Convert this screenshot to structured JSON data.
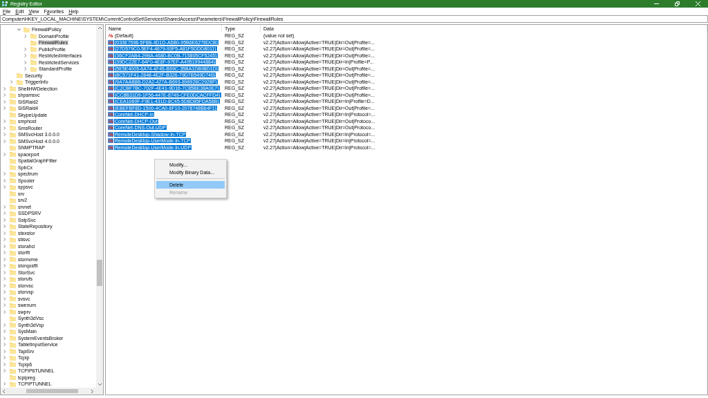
{
  "window": {
    "title": "Registry Editor"
  },
  "menu": [
    {
      "accel": "F",
      "rest": "ile"
    },
    {
      "accel": "E",
      "rest": "dit"
    },
    {
      "accel": "V",
      "rest": "iew"
    },
    {
      "pre": "F",
      "accel": "a",
      "rest": "vorites"
    },
    {
      "accel": "H",
      "rest": "elp"
    }
  ],
  "address": "Computer\\HKEY_LOCAL_MACHINE\\SYSTEM\\CurrentControlSet\\Services\\SharedAccess\\Parameters\\FirewallPolicy\\FirewallRules",
  "tree": [
    {
      "children": [
        {
          "children": [
            {
              "label": "FirewallPolicy",
              "expandable": true,
              "expanded": true,
              "selected": false,
              "children": [
                {
                  "label": "DomainProfile",
                  "expandable": true,
                  "selected": false
                },
                {
                  "label": "FirewallRules",
                  "expandable": false,
                  "selected": true
                },
                {
                  "label": "PublicProfile",
                  "expandable": true,
                  "selected": false
                },
                {
                  "label": "RestrictedInterfaces",
                  "expandable": true,
                  "selected": false
                },
                {
                  "label": "RestrictedServices",
                  "expandable": true,
                  "selected": false
                },
                {
                  "label": "StandardProfile",
                  "expandable": true,
                  "selected": false
                }
              ]
            }
          ]
        },
        {
          "label": "Security",
          "expandable": false,
          "selected": false
        },
        {
          "label": "TriggerInfo",
          "expandable": true,
          "selected": false
        }
      ]
    },
    {
      "label": "ShellHWDetection",
      "expandable": true,
      "selected": false
    },
    {
      "label": "shpamsvc",
      "expandable": true,
      "selected": false
    },
    {
      "label": "SiSRaid2",
      "expandable": true,
      "selected": false
    },
    {
      "label": "SiSRaid4",
      "expandable": true,
      "selected": false
    },
    {
      "label": "SkypeUpdate",
      "expandable": false,
      "selected": false
    },
    {
      "label": "smphost",
      "expandable": true,
      "selected": false
    },
    {
      "label": "SmsRouter",
      "expandable": true,
      "selected": false
    },
    {
      "label": "SMSvcHost 3.0.0.0",
      "expandable": true,
      "selected": false
    },
    {
      "label": "SMSvcHost 4.0.0.0",
      "expandable": true,
      "selected": false
    },
    {
      "label": "SNMPTRAP",
      "expandable": false,
      "selected": false
    },
    {
      "label": "spaceport",
      "expandable": true,
      "selected": false
    },
    {
      "label": "SpatialGraphFilter",
      "expandable": false,
      "selected": false
    },
    {
      "label": "SpbCx",
      "expandable": false,
      "selected": false
    },
    {
      "label": "spectrum",
      "expandable": true,
      "selected": false
    },
    {
      "label": "Spooler",
      "expandable": true,
      "selected": false
    },
    {
      "label": "sppsvc",
      "expandable": true,
      "selected": false
    },
    {
      "label": "srv",
      "expandable": false,
      "selected": false
    },
    {
      "label": "srv2",
      "expandable": false,
      "selected": false
    },
    {
      "label": "srvnet",
      "expandable": true,
      "selected": false
    },
    {
      "label": "SSDPSRV",
      "expandable": true,
      "selected": false
    },
    {
      "label": "SstpSvc",
      "expandable": true,
      "selected": false
    },
    {
      "label": "StateRepository",
      "expandable": true,
      "selected": false
    },
    {
      "label": "stexstor",
      "expandable": true,
      "selected": false
    },
    {
      "label": "stisvc",
      "expandable": true,
      "selected": false
    },
    {
      "label": "storahci",
      "expandable": true,
      "selected": false
    },
    {
      "label": "storflt",
      "expandable": true,
      "selected": false
    },
    {
      "label": "stornvme",
      "expandable": true,
      "selected": false
    },
    {
      "label": "storqosflt",
      "expandable": true,
      "selected": false
    },
    {
      "label": "StorSvc",
      "expandable": true,
      "selected": false
    },
    {
      "label": "storufs",
      "expandable": true,
      "selected": false
    },
    {
      "label": "storvsc",
      "expandable": true,
      "selected": false
    },
    {
      "label": "storvsp",
      "expandable": true,
      "selected": false
    },
    {
      "label": "svsvc",
      "expandable": true,
      "selected": false
    },
    {
      "label": "swenum",
      "expandable": true,
      "selected": false
    },
    {
      "label": "swprv",
      "expandable": true,
      "selected": false
    },
    {
      "label": "Synth3dVsc",
      "expandable": false,
      "selected": false
    },
    {
      "label": "Synth3dVsp",
      "expandable": true,
      "selected": false
    },
    {
      "label": "SysMain",
      "expandable": true,
      "selected": false
    },
    {
      "label": "SystemEventsBroker",
      "expandable": true,
      "selected": false
    },
    {
      "label": "TabletInputService",
      "expandable": true,
      "selected": false
    },
    {
      "label": "TapiSrv",
      "expandable": true,
      "selected": false
    },
    {
      "label": "Tcpip",
      "expandable": true,
      "selected": false
    },
    {
      "label": "Tcpip6",
      "expandable": true,
      "selected": false
    },
    {
      "label": "TCPIP6TUNNEL",
      "expandable": true,
      "selected": false
    },
    {
      "label": "tcpipreg",
      "expandable": false,
      "selected": false
    },
    {
      "label": "TCPIPTUNNEL",
      "expandable": true,
      "selected": false
    }
  ],
  "columns": [
    "Name",
    "Type",
    "Data"
  ],
  "values": [
    {
      "name": "(Default)",
      "type": "REG_SZ",
      "data": "(value not set)",
      "selected": false
    },
    {
      "name": "{033E7598-5F8B-4D1D-A5B0-95B6E6278DCB}",
      "type": "REG_SZ",
      "data": "v2.27|Action=Allow|Active=TRUE|Dir=Out|Profile=...",
      "selected": true
    },
    {
      "name": "{27D579C0-5EF4-4679-93F5-A81F5DDD8011}",
      "type": "REG_SZ",
      "data": "v2.27|Action=Allow|Active=TRUE|Dir=Out|Profile=...",
      "selected": true
    },
    {
      "name": "{36CF2AB4-29BA-4680-BC0B-715805CF5245}",
      "type": "REG_SZ",
      "data": "v2.27|Action=Allow|Active=TRUE|Dir=Out|Profile=...",
      "selected": true
    },
    {
      "name": "{39DC22E7-64F0-4E8F-97EF-A49519944884}",
      "type": "REG_SZ",
      "data": "v2.27|Action=Allow|Active=TRUE|Dir=In|Profile=P...",
      "selected": true
    },
    {
      "name": "{5E5E4005-6A74-4F45-B59C-35BA1DB98D1D}",
      "type": "REG_SZ",
      "data": "v2.27|Action=Allow|Active=TRUE|Dir=Out|Profile=...",
      "selected": true
    },
    {
      "name": "{8C571F41-2848-4E2F-B326-79D7B549D746}",
      "type": "REG_SZ",
      "data": "v2.27|Action=Allow|Active=TRUE|Dir=Out|Profile=...",
      "selected": true
    },
    {
      "name": "{9A7AAB8B-D2A2-427A-B693-898928C2928F}",
      "type": "REG_SZ",
      "data": "v2.27|Action=Allow|Active=TRUE|Dir=Out|Profile=...",
      "selected": true
    },
    {
      "name": "{C2CBF7BC-702F-4E41-9D16-7C85BE38A0E7}",
      "type": "REG_SZ",
      "data": "v2.27|Action=Allow|Active=TRUE|Dir=Out|Profile=...",
      "selected": true
    },
    {
      "name": "{CC8B31D9-1F56-447E-8749-CFE0DCACFFD4}",
      "type": "REG_SZ",
      "data": "v2.27|Action=Allow|Active=TRUE|Dir=Out|Profile=...",
      "selected": true
    },
    {
      "name": "{CEA1060F-F9E1-431D-8C45-5D8D85FDA58B}",
      "type": "REG_SZ",
      "data": "v2.27|Action=Allow|Active=TRUE|Dir=In|Profile=D...",
      "selected": true
    },
    {
      "name": "{EBEFBF8D-1500-4CA0-8F10-2078748B64F1}",
      "type": "REG_SZ",
      "data": "v2.27|Action=Allow|Active=TRUE|Dir=Out|Profile=...",
      "selected": true
    },
    {
      "name": "CoreNet-DHCP-In",
      "type": "REG_SZ",
      "data": "v2.27|Action=Allow|Active=TRUE|Dir=In|Protocol=...",
      "selected": true
    },
    {
      "name": "CoreNet-DHCP-Out",
      "type": "REG_SZ",
      "data": "v2.27|Action=Allow|Active=TRUE|Dir=Out|Protoco...",
      "selected": true
    },
    {
      "name": "CoreNet-DNS-Out-UDP",
      "type": "REG_SZ",
      "data": "v2.27|Action=Allow|Active=TRUE|Dir=Out|Protoco...",
      "selected": true
    },
    {
      "name": "RemoteDesktop-Shadow-In-TCP",
      "type": "REG_SZ",
      "data": "v2.27|Action=Allow|Active=TRUE|Dir=In|Protocol=...",
      "selected": true
    },
    {
      "name": "RemoteDesktop-UserMode-In-TCP",
      "type": "REG_SZ",
      "data": "v2.27|Action=Allow|Active=TRUE|Dir=In|Protocol=...",
      "selected": true
    },
    {
      "name": "RemoteDesktop-UserMode-In-UDP",
      "type": "REG_SZ",
      "data": "v2.27|Action=Allow|Active=TRUE|Dir=In|Protocol=...",
      "selected": true
    }
  ],
  "context_menu": [
    {
      "kind": "item",
      "label": "Modify...",
      "disabled": false,
      "selected": false
    },
    {
      "kind": "item",
      "label": "Modify Binary Data...",
      "disabled": false,
      "selected": false
    },
    {
      "kind": "separator"
    },
    {
      "kind": "item",
      "label": "Delete",
      "disabled": false,
      "selected": true
    },
    {
      "kind": "item",
      "label": "Rename",
      "disabled": true,
      "selected": false
    }
  ]
}
